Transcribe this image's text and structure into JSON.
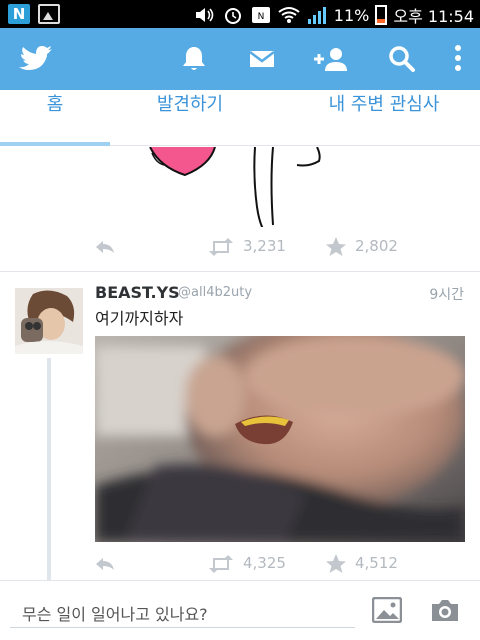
{
  "status_bar": {
    "notification_icons": [
      "notification-n-icon",
      "gallery-notification-icon"
    ],
    "system_icons": [
      "volume-icon",
      "alarm-icon",
      "nfc-icon",
      "wifi-icon",
      "signal-icon",
      "battery-icon"
    ],
    "battery_percent": "11%",
    "time": "오후 11:54",
    "battery_color": "#ff6a2a"
  },
  "app_bar": {
    "color": "#56abe4",
    "icons": [
      "twitter-bird-icon",
      "notifications-bell-icon",
      "messages-envelope-icon",
      "add-user-icon",
      "search-icon",
      "overflow-menu-icon"
    ]
  },
  "tabs": [
    {
      "label": "홈",
      "active": true
    },
    {
      "label": "발견하기",
      "active": false
    },
    {
      "label": "내 주변 관심사",
      "active": false
    }
  ],
  "feed": {
    "tweets": [
      {
        "partial": true,
        "retweets": "3,231",
        "favorites": "2,802"
      },
      {
        "author_name": "BEAST.YS",
        "author_handle": "@all4b2uty",
        "time": "9시간",
        "text": "여기까지하자",
        "retweets": "4,325",
        "favorites": "4,512"
      }
    ]
  },
  "compose": {
    "placeholder": "무슨 일이 일어나고 있나요?",
    "icons": [
      "photo-icon",
      "camera-icon"
    ]
  }
}
